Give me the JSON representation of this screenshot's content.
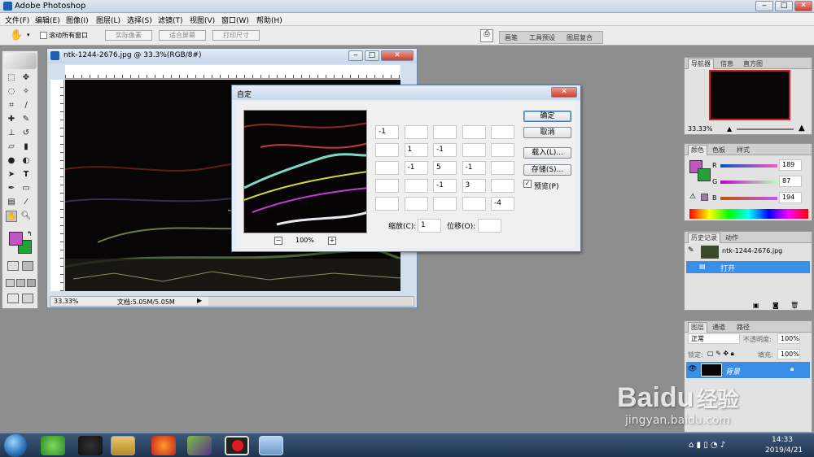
{
  "app": {
    "title": "Adobe Photoshop"
  },
  "menu": [
    "文件(F)",
    "编辑(E)",
    "图像(I)",
    "图层(L)",
    "选择(S)",
    "滤镜(T)",
    "视图(V)",
    "窗口(W)",
    "帮助(H)"
  ],
  "options": {
    "scroll_all": "滚动所有窗口",
    "actual_pixels": "实际像素",
    "fit_screen": "适合屏幕",
    "print_size": "打印尺寸"
  },
  "well_tabs": [
    "画笔",
    "工具预设",
    "图层复合"
  ],
  "document": {
    "title": "ntk-1244-2676.jpg @ 33.3%(RGB/8#)",
    "zoom": "33.33%",
    "doc_size": "文档:5.05M/5.05M"
  },
  "dialog": {
    "title": "自定",
    "preview_zoom": "100%",
    "minus": "−",
    "plus": "+",
    "grid": [
      [
        "-1",
        "",
        "",
        "",
        ""
      ],
      [
        "",
        "1",
        "-1",
        "",
        ""
      ],
      [
        "",
        "-1",
        "5",
        "-1",
        ""
      ],
      [
        "",
        "",
        "-1",
        "3",
        ""
      ],
      [
        "",
        "",
        "",
        "",
        "-4"
      ]
    ],
    "scale_label": "缩放(C):",
    "scale_value": "1",
    "offset_label": "位移(O):",
    "offset_value": "",
    "ok": "确定",
    "cancel": "取消",
    "load": "载入(L)...",
    "save": "存储(S)...",
    "preview_label": "预览(P)"
  },
  "navigator": {
    "tabs": [
      "导航器",
      "信息",
      "直方图"
    ],
    "zoom": "33.33%"
  },
  "color": {
    "tabs": [
      "颜色",
      "色板",
      "样式"
    ],
    "r": "189",
    "g": "87",
    "b": "194",
    "r_label": "R",
    "g_label": "G",
    "b_label": "B",
    "fg": "#bd57c2",
    "bg": "#22a336"
  },
  "history": {
    "tabs": [
      "历史记录",
      "动作"
    ],
    "snapshot": "ntk-1244-2676.jpg",
    "open": "打开"
  },
  "layers": {
    "tabs": [
      "图层",
      "通道",
      "路径"
    ],
    "mode": "正常",
    "opacity_label": "不透明度:",
    "opacity": "100%",
    "lock_label": "锁定:",
    "fill_label": "填充:",
    "fill": "100%",
    "layer_name": "背景"
  },
  "taskbar": {
    "time": "14:33",
    "date": "2019/4/21"
  },
  "watermark": {
    "brand": "Baidu",
    "brand_cn": "经验",
    "url": "jingyan.baidu.com"
  }
}
